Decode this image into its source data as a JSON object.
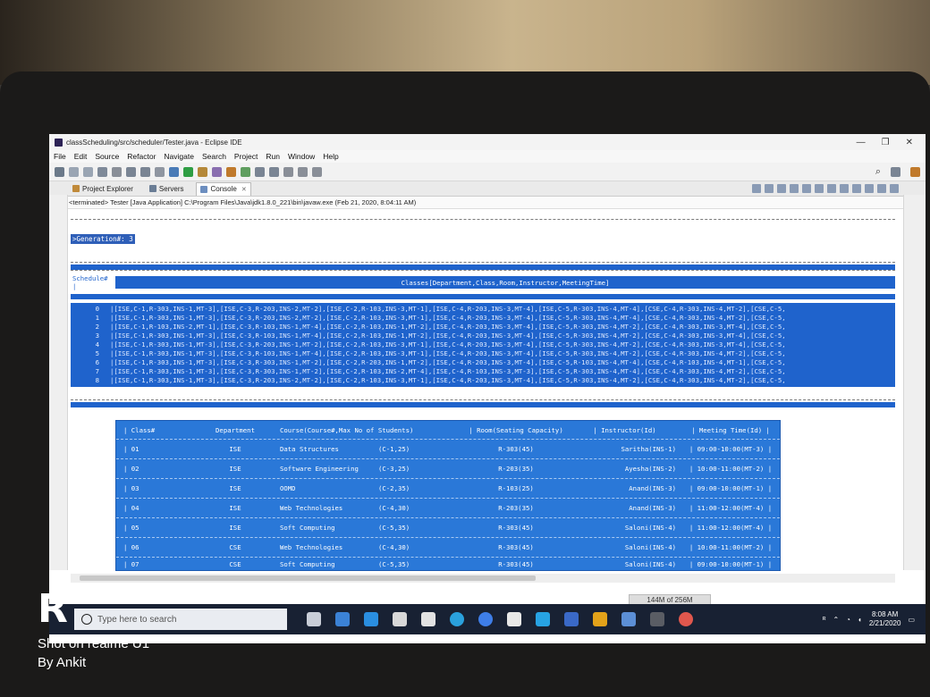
{
  "window": {
    "title": "classScheduling/src/scheduler/Tester.java - Eclipse IDE",
    "controls": [
      "—",
      "❐",
      "✕"
    ]
  },
  "menu": [
    "File",
    "Edit",
    "Source",
    "Refactor",
    "Navigate",
    "Search",
    "Project",
    "Run",
    "Window",
    "Help"
  ],
  "tabs": [
    {
      "label": "Project Explorer"
    },
    {
      "label": "Servers"
    },
    {
      "label": "Console",
      "active": true
    }
  ],
  "terminated_line": "<terminated> Tester [Java Application] C:\\Program Files\\Java\\jdk1.8.0_221\\bin\\javaw.exe (Feb 21, 2020, 8:04:11 AM)",
  "console": {
    "generation": ">Generation#: 3",
    "schedule_header_left": "Schedule# |",
    "schedule_header_title": "Classes[Department,Class,Room,Instructor,MeetingTime]",
    "schedule_rows": [
      {
        "idx": "0",
        "text": "|[ISE,C-1,R-303,INS-1,MT-3],[ISE,C-3,R-203,INS-2,MT-2],[ISE,C-2,R-103,INS-3,MT-1],[ISE,C-4,R-203,INS-3,MT-4],[ISE,C-5,R-303,INS-4,MT-4],[CSE,C-4,R-303,INS-4,MT-2],[CSE,C-5,"
      },
      {
        "idx": "1",
        "text": "|[ISE,C-1,R-303,INS-1,MT-3],[ISE,C-3,R-203,INS-2,MT-2],[ISE,C-2,R-103,INS-3,MT-1],[ISE,C-4,R-203,INS-3,MT-4],[ISE,C-5,R-303,INS-4,MT-4],[CSE,C-4,R-303,INS-4,MT-2],[CSE,C-5,"
      },
      {
        "idx": "2",
        "text": "|[ISE,C-1,R-103,INS-2,MT-1],[ISE,C-3,R-103,INS-1,MT-4],[ISE,C-2,R-103,INS-1,MT-2],[ISE,C-4,R-203,INS-3,MT-4],[ISE,C-5,R-303,INS-4,MT-2],[CSE,C-4,R-303,INS-3,MT-4],[CSE,C-5,"
      },
      {
        "idx": "3",
        "text": "|[ISE,C-1,R-303,INS-1,MT-3],[ISE,C-3,R-103,INS-1,MT-4],[ISE,C-2,R-103,INS-1,MT-2],[ISE,C-4,R-203,INS-3,MT-4],[ISE,C-5,R-303,INS-4,MT-2],[CSE,C-4,R-303,INS-3,MT-4],[CSE,C-5,"
      },
      {
        "idx": "4",
        "text": "|[ISE,C-1,R-303,INS-1,MT-3],[ISE,C-3,R-203,INS-1,MT-2],[ISE,C-2,R-103,INS-3,MT-1],[ISE,C-4,R-203,INS-3,MT-4],[ISE,C-5,R-303,INS-4,MT-2],[CSE,C-4,R-303,INS-3,MT-4],[CSE,C-5,"
      },
      {
        "idx": "5",
        "text": "|[ISE,C-1,R-303,INS-1,MT-3],[ISE,C-3,R-103,INS-1,MT-4],[ISE,C-2,R-103,INS-3,MT-1],[ISE,C-4,R-203,INS-3,MT-4],[ISE,C-5,R-303,INS-4,MT-2],[CSE,C-4,R-303,INS-4,MT-2],[CSE,C-5,"
      },
      {
        "idx": "6",
        "text": "|[ISE,C-1,R-303,INS-1,MT-3],[ISE,C-3,R-303,INS-1,MT-2],[ISE,C-2,R-203,INS-1,MT-2],[ISE,C-4,R-203,INS-3,MT-4],[ISE,C-5,R-103,INS-4,MT-4],[CSE,C-4,R-103,INS-4,MT-1],[CSE,C-5,"
      },
      {
        "idx": "7",
        "text": "|[ISE,C-1,R-303,INS-1,MT-3],[ISE,C-3,R-303,INS-1,MT-2],[ISE,C-2,R-103,INS-2,MT-4],[ISE,C-4,R-103,INS-3,MT-3],[ISE,C-5,R-303,INS-4,MT-4],[CSE,C-4,R-303,INS-4,MT-2],[CSE,C-5,"
      },
      {
        "idx": "8",
        "text": "|[ISE,C-1,R-303,INS-1,MT-3],[ISE,C-3,R-203,INS-2,MT-2],[ISE,C-2,R-103,INS-3,MT-1],[ISE,C-4,R-203,INS-3,MT-4],[ISE,C-5,R-303,INS-4,MT-2],[CSE,C-4,R-303,INS-4,MT-2],[CSE,C-5,"
      }
    ],
    "table_headers": [
      "| Class#",
      "Department",
      "Course(Course#,Max No of Students)",
      "| Room(Seating Capacity)",
      "| Instructor(Id)",
      "| Meeting Time(Id) |"
    ],
    "table_rows": [
      {
        "cls": "| 01",
        "dept": "ISE",
        "course": "Data Structures",
        "code": "(C-1,25)",
        "room": "R-303(45)",
        "inst": "Saritha(INS-1)",
        "time": "| 09:00-10:00(MT-3) |"
      },
      {
        "cls": "| 02",
        "dept": "ISE",
        "course": "Software Engineering",
        "code": "(C-3,25)",
        "room": "R-203(35)",
        "inst": "Ayesha(INS-2)",
        "time": "| 10:00-11:00(MT-2) |"
      },
      {
        "cls": "| 03",
        "dept": "ISE",
        "course": "OOMD",
        "code": "(C-2,35)",
        "room": "R-103(25)",
        "inst": "Anand(INS-3)",
        "time": "| 09:00-10:00(MT-1) |"
      },
      {
        "cls": "| 04",
        "dept": "ISE",
        "course": "Web Technologies",
        "code": "(C-4,30)",
        "room": "R-203(35)",
        "inst": "Anand(INS-3)",
        "time": "| 11:00-12:00(MT-4) |"
      },
      {
        "cls": "| 05",
        "dept": "ISE",
        "course": "Soft Computing",
        "code": "(C-5,35)",
        "room": "R-303(45)",
        "inst": "Saloni(INS-4)",
        "time": "| 11:00-12:00(MT-4) |"
      },
      {
        "cls": "| 06",
        "dept": "CSE",
        "course": "Web Technologies",
        "code": "(C-4,30)",
        "room": "R-303(45)",
        "inst": "Saloni(INS-4)",
        "time": "| 10:00-11:00(MT-2) |"
      },
      {
        "cls": "| 07",
        "dept": "CSE",
        "course": "Soft Computing",
        "code": "(C-5,35)",
        "room": "R-303(45)",
        "inst": "Saloni(INS-4)",
        "time": "| 09:00-10:00(MT-1) |"
      }
    ]
  },
  "memory": "144M of 256M",
  "taskbar": {
    "search_placeholder": "Type here to search",
    "time": "8:08 AM",
    "date": "2/21/2020"
  },
  "watermark": {
    "logo": "R",
    "line1": "Shot on realme U1",
    "line2": "By Ankit"
  }
}
